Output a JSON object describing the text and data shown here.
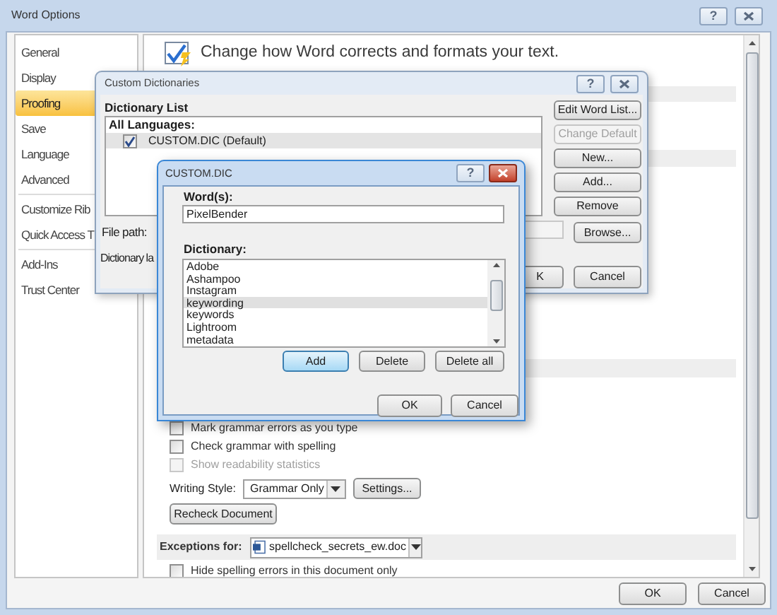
{
  "window": {
    "title": "Word Options",
    "help": "?"
  },
  "sidebar": {
    "groups": [
      [
        {
          "label": "General",
          "selected": false
        },
        {
          "label": "Display",
          "selected": false
        },
        {
          "label": "Proofing",
          "selected": true
        },
        {
          "label": "Save",
          "selected": false
        },
        {
          "label": "Language",
          "selected": false
        },
        {
          "label": "Advanced",
          "selected": false
        }
      ],
      [
        {
          "label": "Customize Rib",
          "selected": false
        },
        {
          "label": "Quick Access T",
          "selected": false
        }
      ],
      [
        {
          "label": "Add-Ins",
          "selected": false
        },
        {
          "label": "Trust Center",
          "selected": false
        }
      ]
    ]
  },
  "header": {
    "text": "Change how Word corrects and formats your text."
  },
  "grammar_options": [
    {
      "label": "Mark grammar errors as you type",
      "checked": false,
      "disabled": false
    },
    {
      "label": "Check grammar with spelling",
      "checked": false,
      "disabled": false
    },
    {
      "label": "Show readability statistics",
      "checked": false,
      "disabled": true
    }
  ],
  "writing_style": {
    "label": "Writing Style:",
    "value": "Grammar Only",
    "settings_button": "Settings..."
  },
  "recheck_button": "Recheck Document",
  "exceptions": {
    "label": "Exceptions for:",
    "document": "spellcheck_secrets_ew.doc",
    "option": {
      "label": "Hide spelling errors in this document only",
      "checked": false
    }
  },
  "buttons": [
    "OK",
    "Cancel"
  ],
  "custom_dictionaries": {
    "title": "Custom Dictionaries",
    "help": "?",
    "list_heading": "Dictionary List",
    "group": "All Languages:",
    "dictionaries": [
      {
        "label": "CUSTOM.DIC (Default)",
        "checked": true,
        "selected": true
      }
    ],
    "side_buttons": [
      {
        "label": "Edit Word List...",
        "disabled": false
      },
      {
        "label": "Change Default",
        "disabled": true
      },
      {
        "label": "New...",
        "disabled": false
      },
      {
        "label": "Add...",
        "disabled": false
      },
      {
        "label": "Remove",
        "disabled": false
      }
    ],
    "browse_button": "Browse...",
    "file_path_label": "File path:",
    "language_label": "Dictionary la",
    "ok_button": "K",
    "cancel_button": "Cancel"
  },
  "custom_dic": {
    "title": "CUSTOM.DIC",
    "help": "?",
    "words_label": "Word(s):",
    "words_value": "PixelBender",
    "dictionary_label": "Dictionary:",
    "entries": [
      {
        "label": "Adobe",
        "selected": false
      },
      {
        "label": "Ashampoo",
        "selected": false
      },
      {
        "label": "Instagram",
        "selected": false
      },
      {
        "label": "keywording",
        "selected": true
      },
      {
        "label": "keywords",
        "selected": false
      },
      {
        "label": "Lightroom",
        "selected": false
      },
      {
        "label": "metadata",
        "selected": false
      }
    ],
    "buttons": [
      {
        "label": "Add",
        "default": true
      },
      {
        "label": "Delete",
        "default": false
      },
      {
        "label": "Delete all",
        "default": false
      }
    ],
    "ok_button": "OK",
    "cancel_button": "Cancel"
  }
}
